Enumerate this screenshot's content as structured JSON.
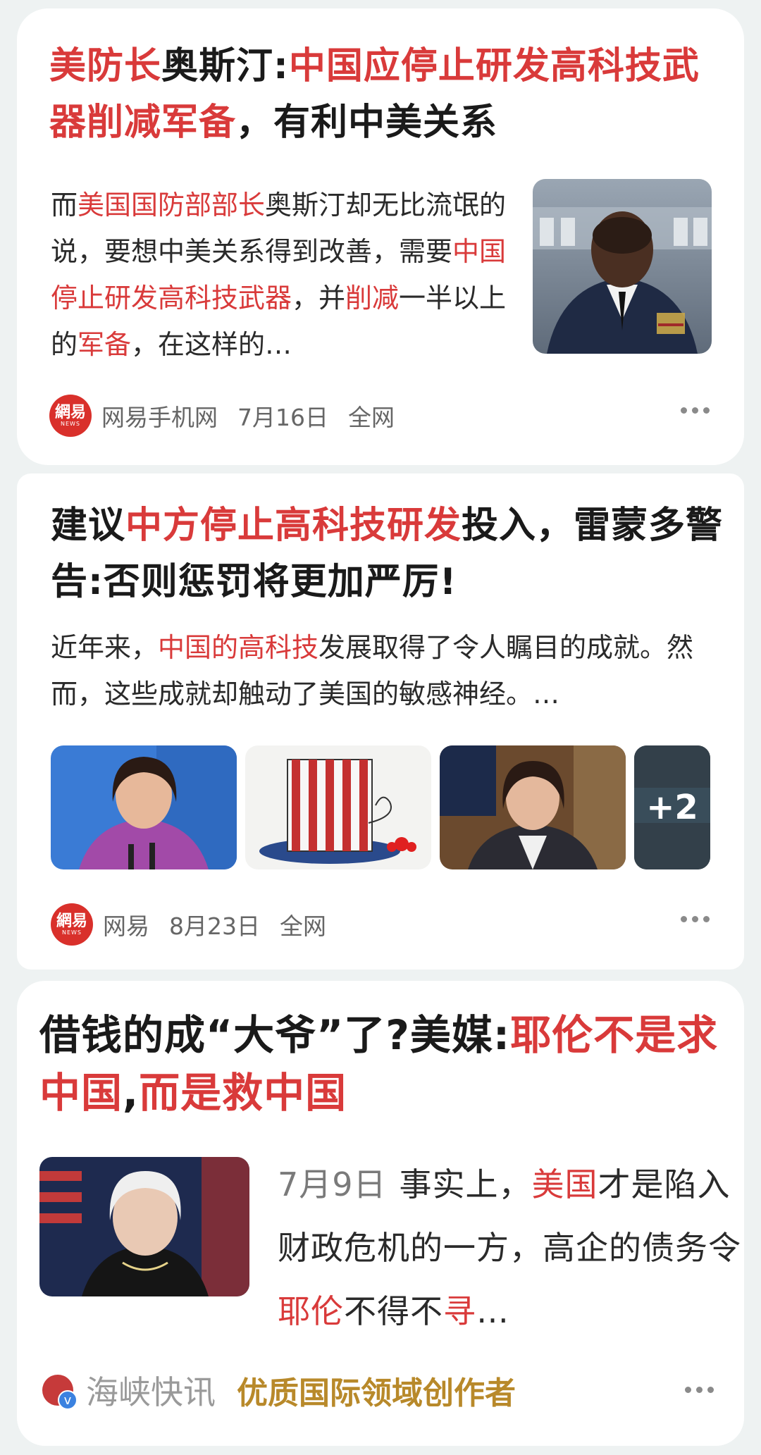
{
  "cards": [
    {
      "title": [
        "美防长",
        "奥斯汀:",
        "中国应停止研发高科技武器削减军备",
        "，有利中美关系"
      ],
      "summary": [
        "而",
        "美国国防部部长",
        "奥斯汀却无比流氓的说，要想中美关系得到改善，需要",
        "中国停止研发高科技武器",
        "，并",
        "削减",
        "一半以上的",
        "军备",
        "，在这样的…"
      ],
      "source": "网易手机网",
      "date": "7月16日",
      "scope": "全网",
      "logo_text": "網易",
      "logo_sub": "NEWS"
    },
    {
      "title": [
        "建议",
        "中方停止高科技研发",
        "投入，雷蒙多警告:否则惩罚将更加严厉!"
      ],
      "summary": [
        "近年来，",
        "中国的高科技",
        "发展取得了令人瞩目的成就。然而，这些成就却触动了美国的敏感神经。…"
      ],
      "more_images": "+2",
      "source": "网易",
      "date": "8月23日",
      "scope": "全网",
      "logo_text": "網易",
      "logo_sub": "NEWS"
    },
    {
      "title": [
        "借钱的成“大爷”了?美媒:",
        "耶伦不是求中国",
        ",",
        "而是救中国"
      ],
      "date": "7月9日",
      "summary": [
        "事实上，",
        "美国",
        "才是陷入财政危机的一方，高企的债务令",
        "耶伦",
        "不得不",
        "寻",
        "…"
      ],
      "source": "海峡快讯",
      "badge": "优质国际领域创作者"
    }
  ],
  "colors": {
    "highlight": "#d93a3a",
    "badge": "#b8892a",
    "logo": "#d9302b"
  }
}
